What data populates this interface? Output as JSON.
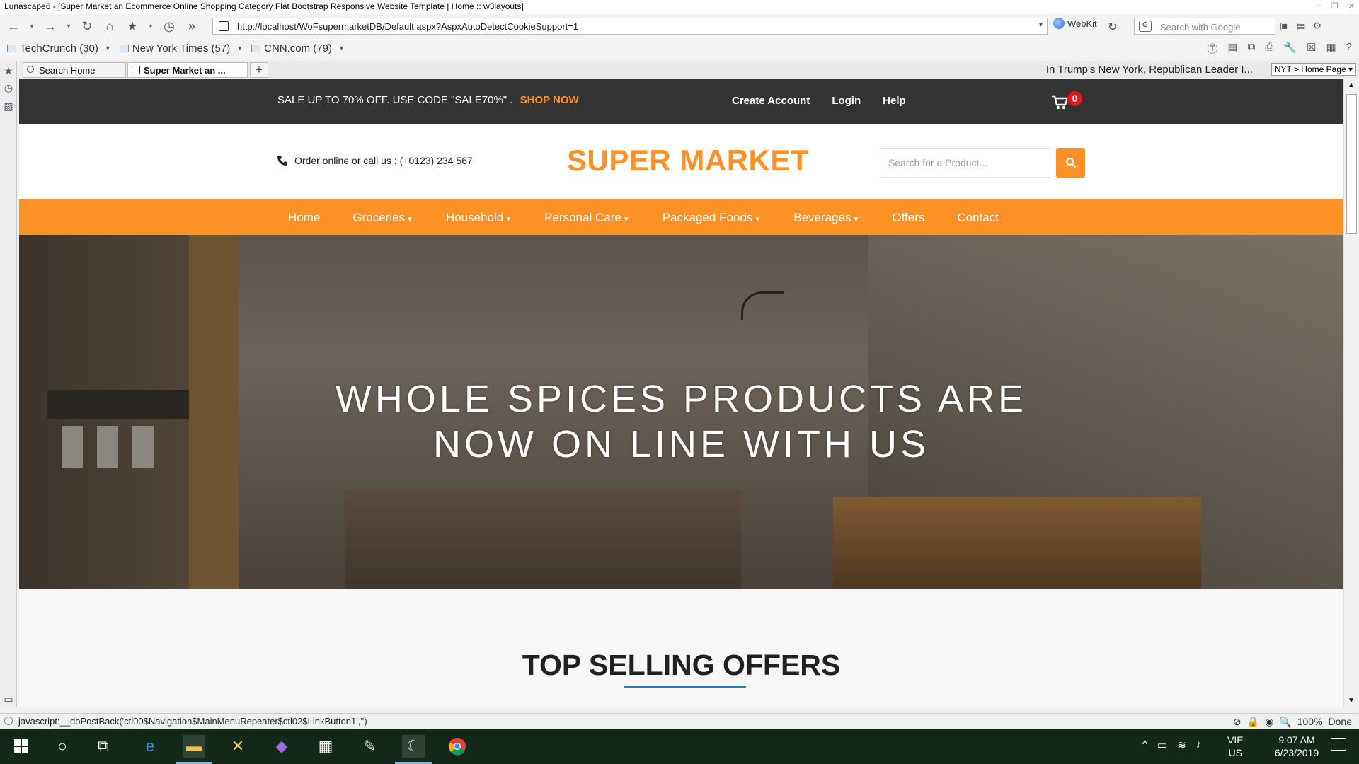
{
  "window": {
    "title": "Lunascape6 - [Super Market an Ecommerce Online Shopping Category Flat Bootstrap Responsive Website Template | Home :: w3layouts]"
  },
  "browser": {
    "url": "http://localhost/WoFsupermarketDB/Default.aspx?AspxAutoDetectCookieSupport=1",
    "engine": "WebKit",
    "search_placeholder": "Search with Google",
    "bookmarks": [
      {
        "label": "TechCrunch (30)"
      },
      {
        "label": "New York Times (57)"
      },
      {
        "label": "CNN.com (79)"
      }
    ],
    "tabs": [
      {
        "label": "Search Home"
      },
      {
        "label": "Super Market an ..."
      }
    ],
    "ticker": "In Trump's New York, Republican Leader I...",
    "nyt": "NYT > Home Page",
    "status_text": "javascript:__doPostBack('ctl00$Navigation$MainMenuRepeater$ctl02$LinkButton1','')",
    "zoom": "100%",
    "status_done": "Done"
  },
  "page": {
    "promo_text": "SALE UP TO 70% OFF. USE CODE \"SALE70%\" .",
    "promo_cta": "SHOP NOW",
    "account_links": [
      "Create Account",
      "Login",
      "Help"
    ],
    "cart_count": "0",
    "contact_text": "Order online or call us : (+0123) 234 567",
    "logo": "SUPER MARKET",
    "search_placeholder": "Search for a Product...",
    "nav": [
      {
        "label": "Home",
        "dropdown": false
      },
      {
        "label": "Groceries",
        "dropdown": true
      },
      {
        "label": "Household",
        "dropdown": true
      },
      {
        "label": "Personal Care",
        "dropdown": true
      },
      {
        "label": "Packaged Foods",
        "dropdown": true
      },
      {
        "label": "Beverages",
        "dropdown": true
      },
      {
        "label": "Offers",
        "dropdown": false
      },
      {
        "label": "Contact",
        "dropdown": false
      }
    ],
    "hero_line1": "WHOLE SPICES PRODUCTS ARE",
    "hero_line2": "NOW ON LINE WITH US",
    "section_title": "TOP SELLING OFFERS"
  },
  "taskbar": {
    "lang_line1": "VIE",
    "lang_line2": "US",
    "time": "9:07 AM",
    "date": "6/23/2019"
  },
  "colors": {
    "accent": "#fe9126",
    "topbar": "#333333",
    "badge": "#e8141c",
    "underline": "#2a7ab5"
  }
}
